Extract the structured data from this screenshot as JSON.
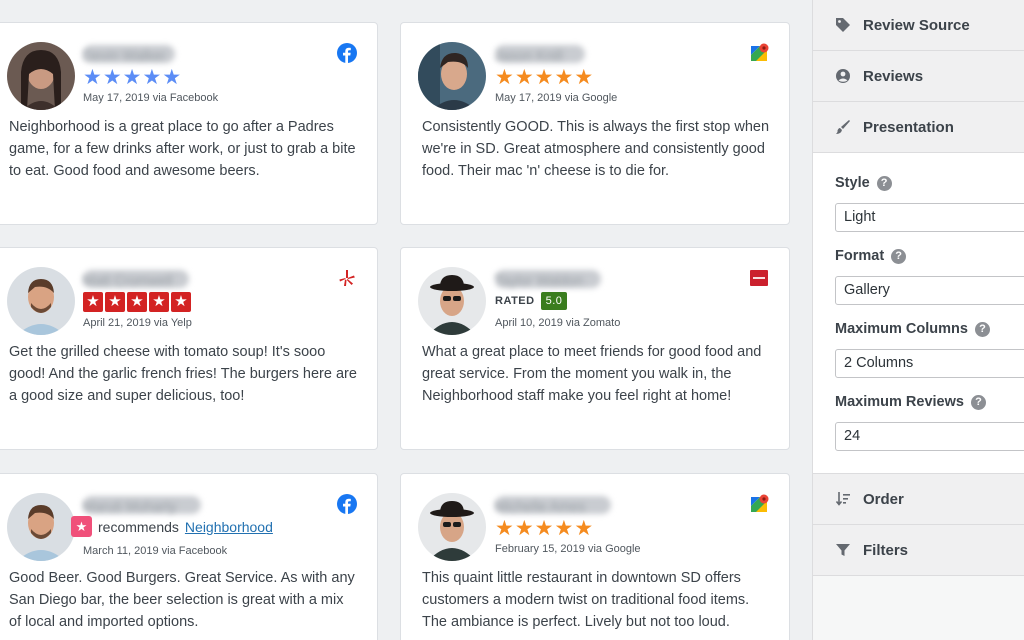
{
  "reviews": [
    {
      "name": "Devin Walker",
      "date": "May 17, 2019 via Facebook",
      "text": "Neighborhood is a great place to go after a Padres game, for a few drinks after work, or just to grab a bite to eat. Good food and awesome beers.",
      "source": "facebook-icon",
      "rating": 5
    },
    {
      "name": "Jason Knill",
      "date": "May 17, 2019 via Google",
      "text": "Consistently GOOD. This is always the first stop when we're in SD. Great atmosphere and consistently good food. Their mac 'n' cheese is to die for.",
      "source": "google-maps-icon",
      "rating": 5
    },
    {
      "name": "Matt Cromwell",
      "date": "April 21, 2019 via Yelp",
      "text": "Get the grilled cheese with tomato soup! It's sooo good! And the garlic french fries! The burgers here are a good size and super delicious, too!",
      "source": "yelp-icon",
      "rating": 5
    },
    {
      "name": "Taylor Waldon",
      "rated_label": "RATED",
      "score": "5.0",
      "date": "April 10, 2019 via Zomato",
      "text": "What a great place to meet friends for good food and great service. From the moment you walk in, the Neighborhood staff make you feel right at home!",
      "source": "zomato-icon"
    },
    {
      "name": "Maruti Moharty",
      "recommends": "recommends",
      "business": "Neighborhood",
      "date": "March 11, 2019 via Facebook",
      "text": "Good Beer. Good Burgers. Great Service. As with any San Diego bar, the beer selection is great with a mix of local and imported options.",
      "source": "facebook-icon"
    },
    {
      "name": "Michelle Ames",
      "date": "February 15, 2019 via Google",
      "text": "This quaint little restaurant in downtown SD offers customers a modern twist on traditional food items. The ambiance is perfect. Lively but not too loud.",
      "source": "google-maps-icon",
      "rating": 5
    }
  ],
  "sidebar": {
    "review_source": "Review Source",
    "reviews": "Reviews",
    "presentation": "Presentation",
    "style_label": "Style",
    "style_value": "Light",
    "format_label": "Format",
    "format_value": "Gallery",
    "max_columns_label": "Maximum Columns",
    "max_columns_value": "2 Columns",
    "max_reviews_label": "Maximum Reviews",
    "max_reviews_value": "24",
    "order": "Order",
    "filters": "Filters"
  },
  "colors": {
    "facebook_star": "#5c8df6",
    "google_star": "#f58b1f",
    "yelp_red": "#d32323",
    "zomato_green": "#3a7d1e",
    "link": "#2271b1"
  }
}
